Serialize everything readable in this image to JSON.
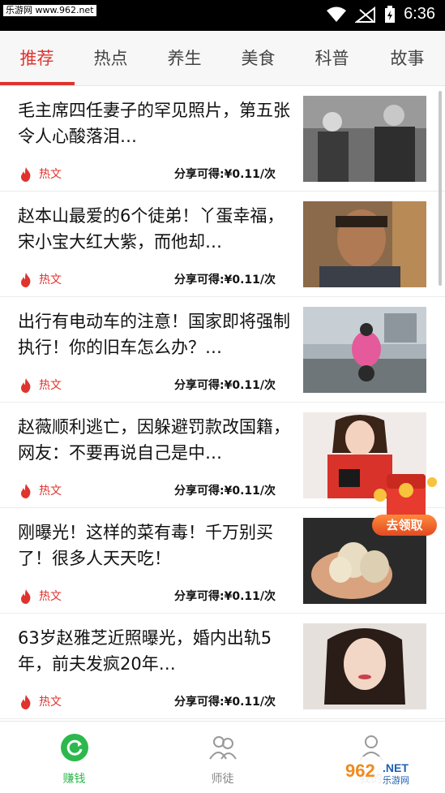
{
  "status_bar": {
    "watermark": "乐游网 www.962.net",
    "time": "6:36"
  },
  "tabs": [
    {
      "label": "推荐",
      "active": true
    },
    {
      "label": "热点",
      "active": false
    },
    {
      "label": "养生",
      "active": false
    },
    {
      "label": "美食",
      "active": false
    },
    {
      "label": "科普",
      "active": false
    },
    {
      "label": "故事",
      "active": false
    }
  ],
  "feed": {
    "items": [
      {
        "title": "毛主席四任妻子的罕见照片，第五张令人心酸落泪…",
        "tag": "热文",
        "share": "分享可得:¥0.11/次"
      },
      {
        "title": "赵本山最爱的6个徒弟！丫蛋幸福，宋小宝大红大紫，而他却…",
        "tag": "热文",
        "share": "分享可得:¥0.11/次"
      },
      {
        "title": "出行有电动车的注意！国家即将强制执行！你的旧车怎么办？…",
        "tag": "热文",
        "share": "分享可得:¥0.11/次"
      },
      {
        "title": "赵薇顺利逃亡，因躲避罚款改国籍，网友：不要再说自己是中…",
        "tag": "热文",
        "share": "分享可得:¥0.11/次"
      },
      {
        "title": "刚曝光！这样的菜有毒！千万别买了！很多人天天吃！",
        "tag": "热文",
        "share": "分享可得:¥0.11/次"
      },
      {
        "title": "63岁赵雅芝近照曝光，婚内出轨5年，前夫发疯20年…",
        "tag": "热文",
        "share": "分享可得:¥0.11/次"
      }
    ]
  },
  "envelope": {
    "button_label": "去领取"
  },
  "bottom_nav": [
    {
      "label": "赚钱",
      "icon": "refresh-coin-icon",
      "active": true
    },
    {
      "label": "师徒",
      "icon": "users-icon",
      "active": false
    },
    {
      "label": "我的",
      "icon": "person-icon",
      "active": false
    }
  ],
  "watermark_logo": "962.NET 乐游网",
  "colors": {
    "accent": "#e0332e",
    "nav_active": "#2db84d"
  }
}
